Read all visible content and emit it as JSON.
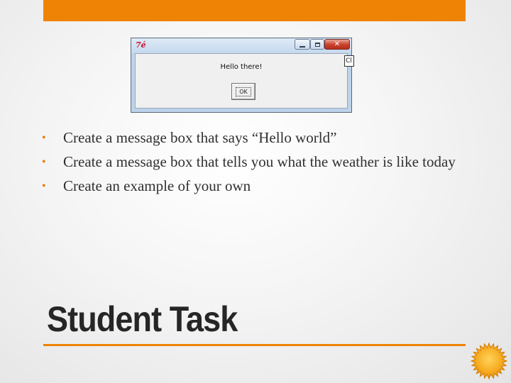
{
  "colors": {
    "accent": "#ef8306",
    "text": "#303030",
    "title": "#262626"
  },
  "screenshot": {
    "logo_text": "7é",
    "message": "Hello there!",
    "ok_label": "OK",
    "cut_text": "Cl",
    "icons": [
      "minimize-icon",
      "maximize-icon",
      "close-icon"
    ]
  },
  "bullets": [
    {
      "text": "Create a message box that says “Hello world”"
    },
    {
      "text": "Create a message box that tells you what the weather is like today"
    },
    {
      "text": "Create an example of your own"
    }
  ],
  "bullet_glyph": "•",
  "title": "Student Task"
}
